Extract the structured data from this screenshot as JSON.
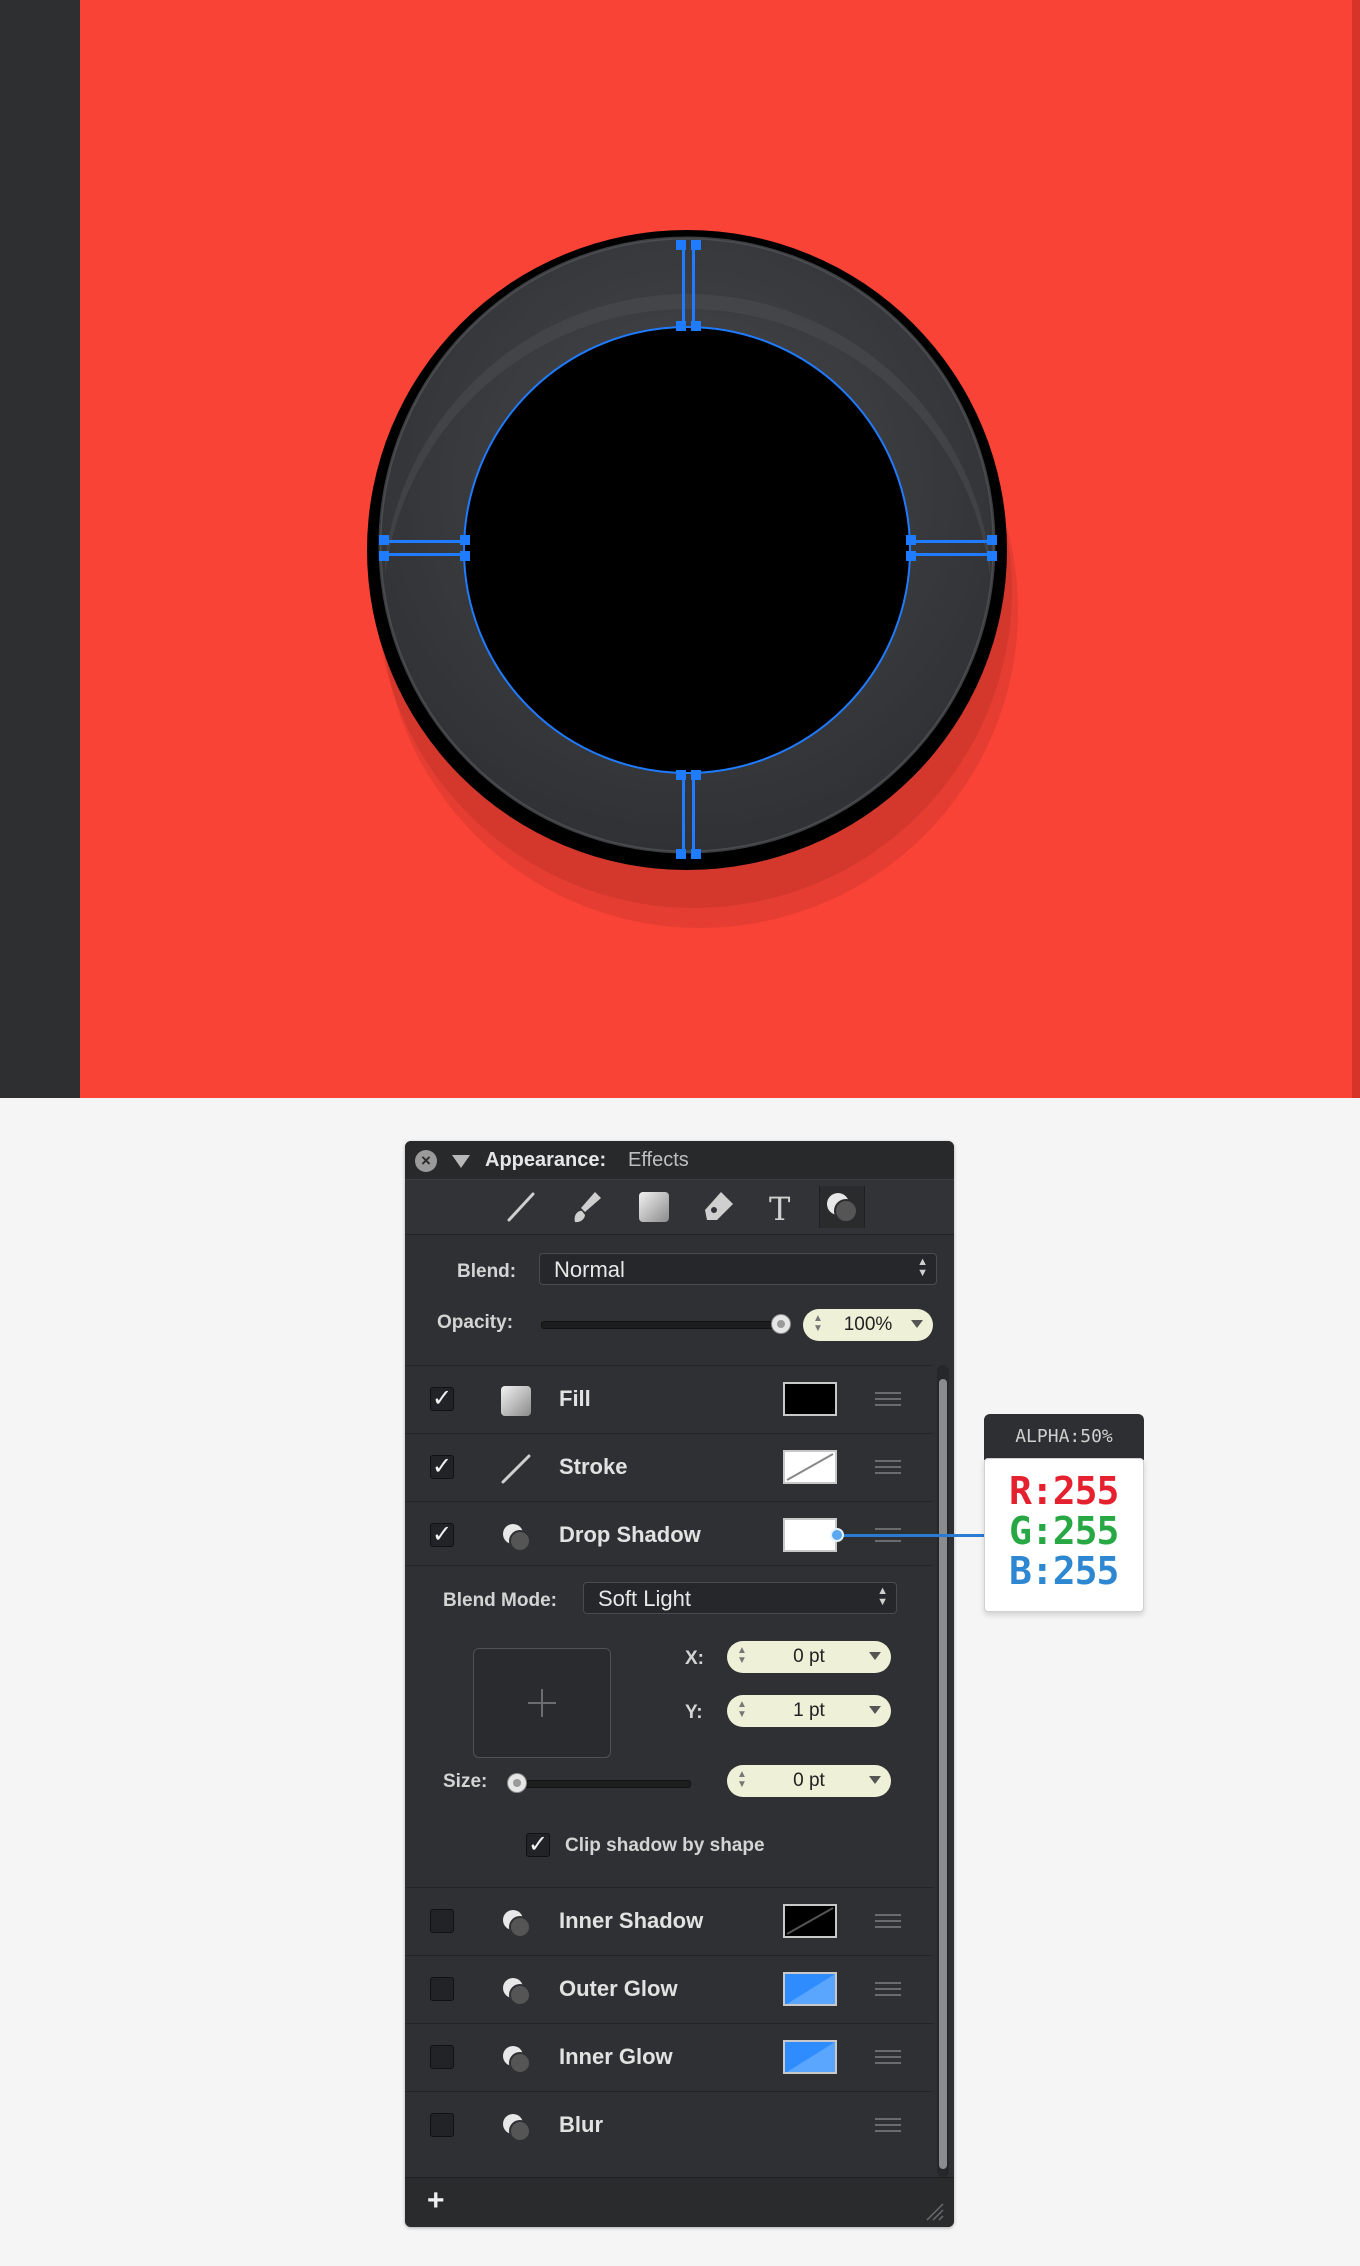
{
  "panel": {
    "title": "Appearance:",
    "subtitle": "Effects",
    "close_glyph": "×",
    "toolbar_icons": [
      "stroke-tool-icon",
      "brush-tool-icon",
      "fill-tool-icon",
      "pen-tool-icon",
      "text-tool-icon",
      "effects-tool-icon"
    ],
    "blend_label": "Blend:",
    "blend_value": "Normal",
    "opacity_label": "Opacity:",
    "opacity_value": "100%",
    "opacity_level": 1.0,
    "effects": [
      {
        "label": "Fill",
        "checked": true,
        "swatch_color": "#000000"
      },
      {
        "label": "Stroke",
        "checked": true,
        "swatch_color": "#ffffff"
      },
      {
        "label": "Drop Shadow",
        "checked": true,
        "swatch_color": "#ffffff"
      },
      {
        "label": "Inner Shadow",
        "checked": false,
        "swatch_color": "#000000"
      },
      {
        "label": "Outer Glow",
        "checked": false,
        "swatch_color": "#2f8cff"
      },
      {
        "label": "Inner Glow",
        "checked": false,
        "swatch_color": "#2f8cff"
      },
      {
        "label": "Blur",
        "checked": false
      }
    ],
    "shadow": {
      "blend_mode_label": "Blend Mode:",
      "blend_mode_value": "Soft Light",
      "x_label": "X:",
      "x_value": "0 pt",
      "y_label": "Y:",
      "y_value": "1 pt",
      "size_label": "Size:",
      "size_value": "0 pt",
      "size_level": 0.0,
      "clip_label": "Clip shadow by shape",
      "clip_checked": true
    },
    "add_glyph": "+"
  },
  "callout": {
    "alpha": "ALPHA:50%",
    "r": "R:255",
    "g": "G:255",
    "b": "B:255",
    "r_color": "#e5212f",
    "g_color": "#27a845",
    "b_color": "#2d87d1"
  },
  "colors": {
    "canvas_background": "#f94336",
    "ring": "#36383b",
    "selection": "#1f7bff"
  }
}
